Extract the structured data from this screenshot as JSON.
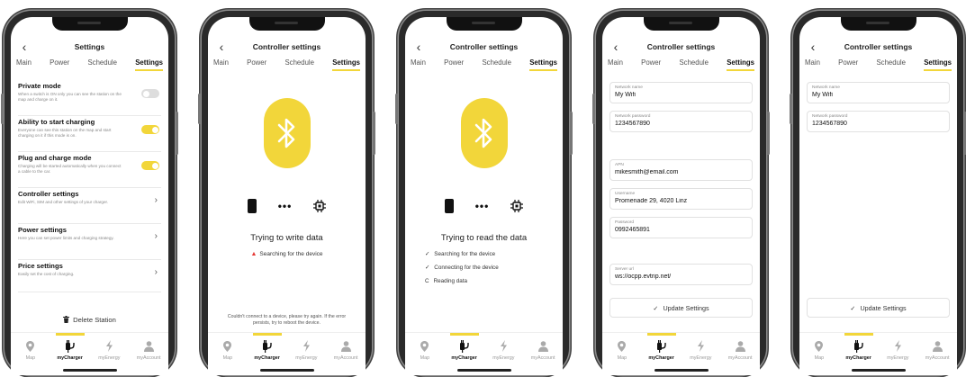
{
  "screen1": {
    "title": "Settings",
    "rows": [
      {
        "title": "Private mode",
        "desc": "When a switch is ON only you can see the station on the map and charge on it."
      },
      {
        "title": "Ability to start charging",
        "desc": "Everyone can see this station on the map and start charging on it if this mode is on."
      },
      {
        "title": "Plug and charge mode",
        "desc": "Charging will be started automatically when you connect a cable to the car."
      },
      {
        "title": "Controller settings",
        "desc": "Edit WiFi, SIM and other settings of your charger."
      },
      {
        "title": "Power settings",
        "desc": "Here you can set power limits and charging strategy."
      },
      {
        "title": "Price settings",
        "desc": "Easily set the cost of charging."
      }
    ],
    "delete_label": "Delete Station"
  },
  "screen2": {
    "title": "Controller settings",
    "status": "Trying to write data",
    "step": "Searching for the device",
    "note": "Couldn't connect to a device, please try again. If the error persists, try to reboot the device."
  },
  "screen3": {
    "title": "Controller settings",
    "status": "Trying to read the data",
    "steps": [
      "Searching for the device",
      "Connecting for the device",
      "Reading data"
    ]
  },
  "screen4": {
    "title": "Controller settings",
    "fields": [
      {
        "label": "Network name",
        "value": "My Wifi"
      },
      {
        "label": "Network password",
        "value": "1234567890"
      },
      {
        "label": "APN",
        "value": "mikesmith@email.com"
      },
      {
        "label": "Username",
        "value": "Promenade 29, 4020 Linz"
      },
      {
        "label": "Password",
        "value": "0992465891"
      },
      {
        "label": "Server url",
        "value": "ws://ocpp.evtrip.net/"
      }
    ],
    "button": "Update Settings"
  },
  "screen5": {
    "title": "Controller settings",
    "fields": [
      {
        "label": "Network name",
        "value": "My Wifi"
      },
      {
        "label": "Network password",
        "value": "1234567890"
      }
    ],
    "button": "Update Settings"
  },
  "tabs": [
    "Main",
    "Power",
    "Schedule",
    "Settings"
  ],
  "nav": [
    "Map",
    "myCharger",
    "myEnergy",
    "myAccount"
  ],
  "icons": {
    "back": "‹",
    "chevron": "›",
    "check": "✓",
    "warning": "▲",
    "spinner": "C"
  },
  "colors": {
    "accent": "#f2d63a",
    "warning": "#e53935"
  }
}
